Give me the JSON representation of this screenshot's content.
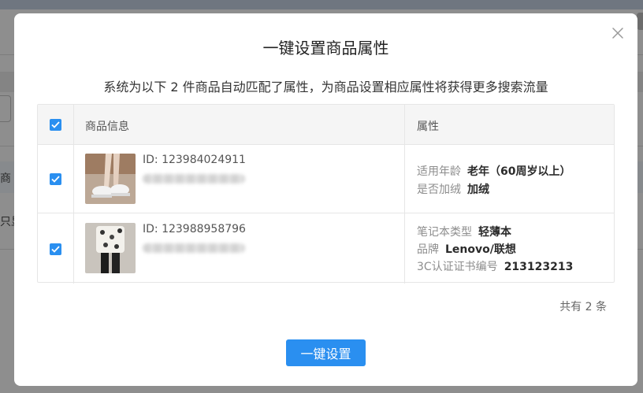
{
  "background": {
    "fragment_left_1": "商",
    "fragment_left_2": "只显"
  },
  "modal": {
    "title": "一键设置商品属性",
    "subtitle": "系统为以下 2 件商品自动匹配了属性，为商品设置相应属性将获得更多搜索流量",
    "close_icon": "close-icon",
    "table": {
      "headers": {
        "product_info": "商品信息",
        "attributes": "属性"
      },
      "rows": [
        {
          "checked": true,
          "id_text": "ID: 123984024911",
          "attributes": [
            {
              "label": "适用年龄",
              "value": "老年（60周岁以上）"
            },
            {
              "label": "是否加绒",
              "value": "加绒"
            }
          ]
        },
        {
          "checked": true,
          "id_text": "ID: 123988958796",
          "attributes": [
            {
              "label": "笔记本类型",
              "value": "轻薄本"
            },
            {
              "label": "品牌",
              "value": "Lenovo/联想"
            },
            {
              "label": "3C认证证书编号",
              "value": "213123213"
            }
          ]
        }
      ]
    },
    "total_text": "共有 2 条",
    "primary_button": "一键设置"
  },
  "colors": {
    "accent": "#2a8ff0",
    "overlay": "#8e8e8e",
    "border": "#e6e6e6",
    "header_bg": "#f5f5f5"
  }
}
